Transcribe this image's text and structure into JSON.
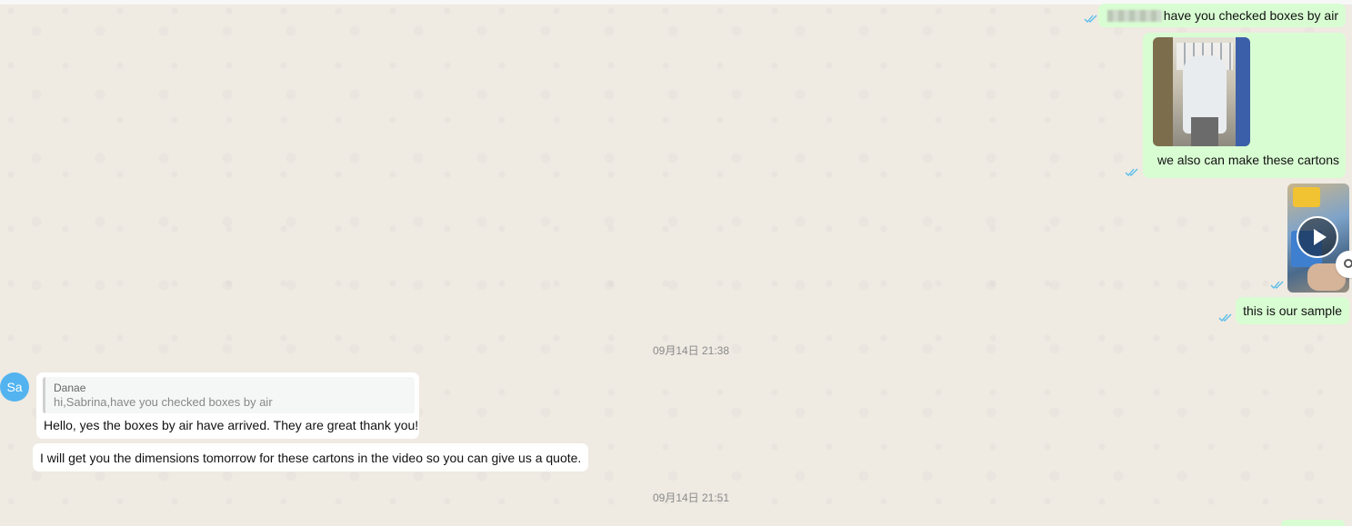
{
  "messages": {
    "m1": {
      "text": "have you checked boxes by air",
      "status": "read"
    },
    "m2": {
      "caption": "we also can make these cartons",
      "status": "read"
    },
    "m3": {
      "type": "video",
      "status": "read"
    },
    "m4": {
      "text": "this is our sample",
      "status": "read"
    }
  },
  "timestamps": [
    "09月14日 21:38",
    "09月14日 21:51"
  ],
  "incoming": {
    "avatar_initials": "Sa",
    "reply": {
      "quote_author": "Danae",
      "quote_text": "hi,Sabrina,have you checked boxes by air",
      "text": "Hello, yes the boxes by air have arrived. They are great thank you!"
    },
    "followup": "I will get you the dimensions tomorrow for these cartons in the video so you can give us a quote."
  },
  "colors": {
    "outgoing_bubble": "#d9fdd3",
    "incoming_bubble": "#ffffff",
    "read_tick": "#53bdeb",
    "background": "#efeae2"
  }
}
